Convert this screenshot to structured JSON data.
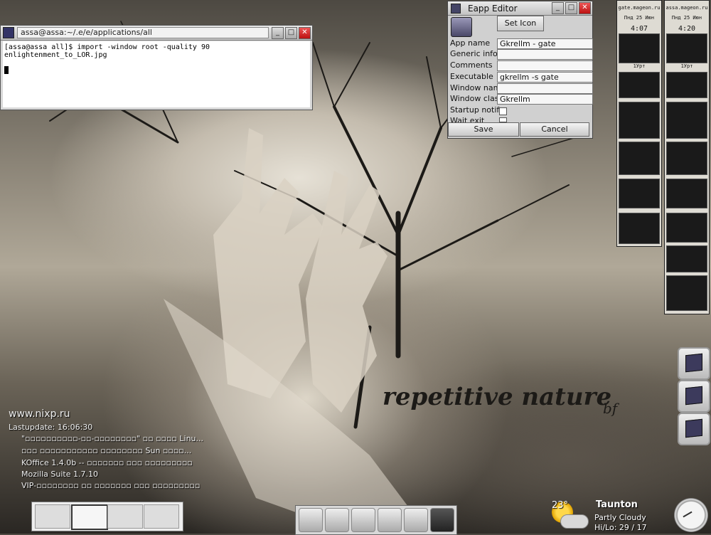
{
  "terminal": {
    "title": "assa@assa:~/.e/e/applications/all",
    "line": "[assa@assa all]$ import -window root -quality 90 enlightenment_to_LOR.jpg"
  },
  "eapp": {
    "title": "Eapp Editor",
    "set_icon": "Set Icon",
    "labels": {
      "app_name": "App name",
      "generic": "Generic info",
      "comments": "Comments",
      "executable": "Executable",
      "window_name": "Window name",
      "window_class": "Window class",
      "startup": "Startup notif",
      "wait": "Wait exit"
    },
    "values": {
      "app_name": "Gkrellm - gate",
      "generic": "",
      "comments": "",
      "executable": "gkrellm -s gate",
      "window_name": "",
      "window_class": "Gkrellm"
    },
    "save": "Save",
    "cancel": "Cancel"
  },
  "gkrellm_left": {
    "host": "gate.mageon.ru",
    "date": "Пнд 25 Июн",
    "time": "4:07",
    "uptime": "1Урт"
  },
  "gkrellm_right": {
    "host": "assa.mageon.ru",
    "date": "Пнд 25 Июн",
    "time": "4:20",
    "uptime": "1Урт"
  },
  "wallpaper": {
    "caption": "repetitive nature",
    "signature": "bf"
  },
  "news": {
    "site": "www.nixp.ru",
    "lastupdate": "Lastupdate: 16:06:30",
    "items": [
      "\"▫▫▫▫▫▫▫▫▫▫-▫▫-▫▫▫▫▫▫▫▫\" ▫▫ ▫▫▫▫ Linu...",
      "▫▫▫ ▫▫▫▫▫▫▫▫▫▫▫ ▫▫▫▫▫▫▫▫ Sun ▫▫▫▫...",
      "KOffice 1.4.0b -- ▫▫▫▫▫▫▫ ▫▫▫ ▫▫▫▫▫▫▫▫▫",
      "Mozilla Suite 1.7.10",
      "VIP-▫▫▫▫▫▫▫▫ ▫▫ ▫▫▫▫▫▫▫ ▫▫▫ ▫▫▫▫▫▫▫▫▫"
    ]
  },
  "weather": {
    "temp": "23°",
    "city": "Taunton",
    "condition": "Partly Cloudy",
    "hilo": "Hi/Lo: 29 / 17"
  }
}
